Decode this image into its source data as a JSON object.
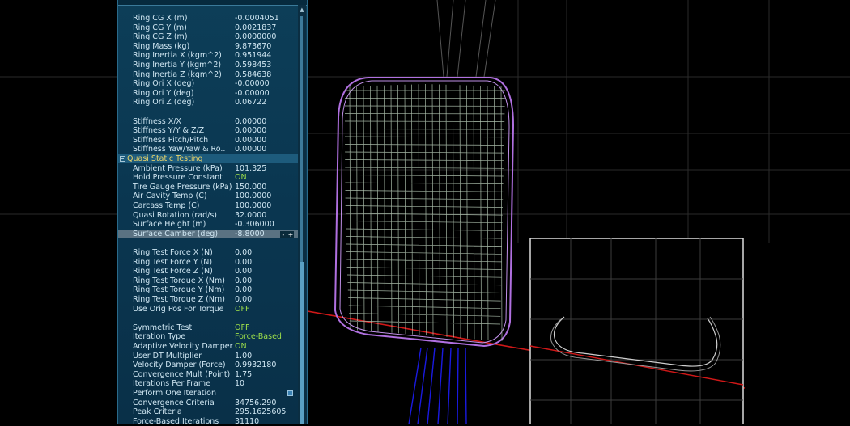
{
  "properties": {
    "ring": [
      {
        "label": "Ring CG X (m)",
        "value": "-0.0004051"
      },
      {
        "label": "Ring CG Y (m)",
        "value": "0.0021837"
      },
      {
        "label": "Ring CG Z (m)",
        "value": "0.0000000"
      },
      {
        "label": "Ring Mass (kg)",
        "value": "9.873670"
      },
      {
        "label": "Ring Inertia X (kgm^2)",
        "value": "0.951944"
      },
      {
        "label": "Ring Inertia Y (kgm^2)",
        "value": "0.598453"
      },
      {
        "label": "Ring Inertia Z (kgm^2)",
        "value": "0.584638"
      },
      {
        "label": "Ring Ori X (deg)",
        "value": "-0.00000"
      },
      {
        "label": "Ring Ori Y (deg)",
        "value": "-0.00000"
      },
      {
        "label": "Ring Ori Z (deg)",
        "value": "0.06722"
      }
    ],
    "stiffness": [
      {
        "label": "Stiffness X/X",
        "value": "0.00000"
      },
      {
        "label": "Stiffness Y/Y & Z/Z",
        "value": "0.00000"
      },
      {
        "label": "Stiffness Pitch/Pitch",
        "value": "0.00000"
      },
      {
        "label": "Stiffness Yaw/Yaw & Ro..",
        "value": "0.00000"
      }
    ],
    "section_title": "Quasi Static Testing",
    "quasi": [
      {
        "label": "Ambient Pressure (kPa)",
        "value": "101.325"
      },
      {
        "label": "Hold Pressure Constant",
        "value": "ON",
        "accent": true
      },
      {
        "label": "Tire Gauge Pressure (kPa)",
        "value": "150.000"
      },
      {
        "label": "Air Cavity Temp (C)",
        "value": "100.0000"
      },
      {
        "label": "Carcass Temp (C)",
        "value": "100.0000"
      },
      {
        "label": "Quasi Rotation (rad/s)",
        "value": "32.0000"
      },
      {
        "label": "Surface Height (m)",
        "value": "-0.306000"
      },
      {
        "label": "Surface Camber (deg)",
        "value": "-8.8000",
        "selected": true
      }
    ],
    "ring_test": [
      {
        "label": "Ring Test Force X (N)",
        "value": "0.00"
      },
      {
        "label": "Ring Test Force Y (N)",
        "value": "0.00"
      },
      {
        "label": "Ring Test Force Z (N)",
        "value": "0.00"
      },
      {
        "label": "Ring Test Torque X (Nm)",
        "value": "0.00"
      },
      {
        "label": "Ring Test Torque Y (Nm)",
        "value": "0.00"
      },
      {
        "label": "Ring Test Torque Z (Nm)",
        "value": "0.00"
      },
      {
        "label": "Use Orig Pos For Torque",
        "value": "OFF",
        "accent": true
      }
    ],
    "solver": [
      {
        "label": "Symmetric Test",
        "value": "OFF",
        "accent": true
      },
      {
        "label": "Iteration Type",
        "value": "Force-Based",
        "accent": true
      },
      {
        "label": "Adaptive Velocity Damper",
        "value": "ON",
        "accent": true
      },
      {
        "label": "User DT Multiplier",
        "value": "1.00"
      },
      {
        "label": "Velocity Damper (Force)",
        "value": "0.9932180"
      },
      {
        "label": "Convergence Mult (Point)",
        "value": "1.75"
      },
      {
        "label": "Iterations Per Frame",
        "value": "10"
      },
      {
        "label": "Perform One Iteration",
        "value": "",
        "checkbox": true
      },
      {
        "label": "Convergence Criteria",
        "value": "34756.290"
      },
      {
        "label": "Peak Criteria",
        "value": "295.1625605"
      },
      {
        "label": "Force-Based Iterations",
        "value": "31110"
      }
    ]
  },
  "spin": {
    "minus": "-",
    "plus": "+"
  },
  "colors": {
    "accent": "#9fe04a",
    "section": "#e8d36a",
    "text": "#cfe6f2",
    "mesh_outer": "#b070e0",
    "mesh_inner": "#b8ccb8",
    "ground_line": "#d01818",
    "strut": "#1a1ae0"
  }
}
